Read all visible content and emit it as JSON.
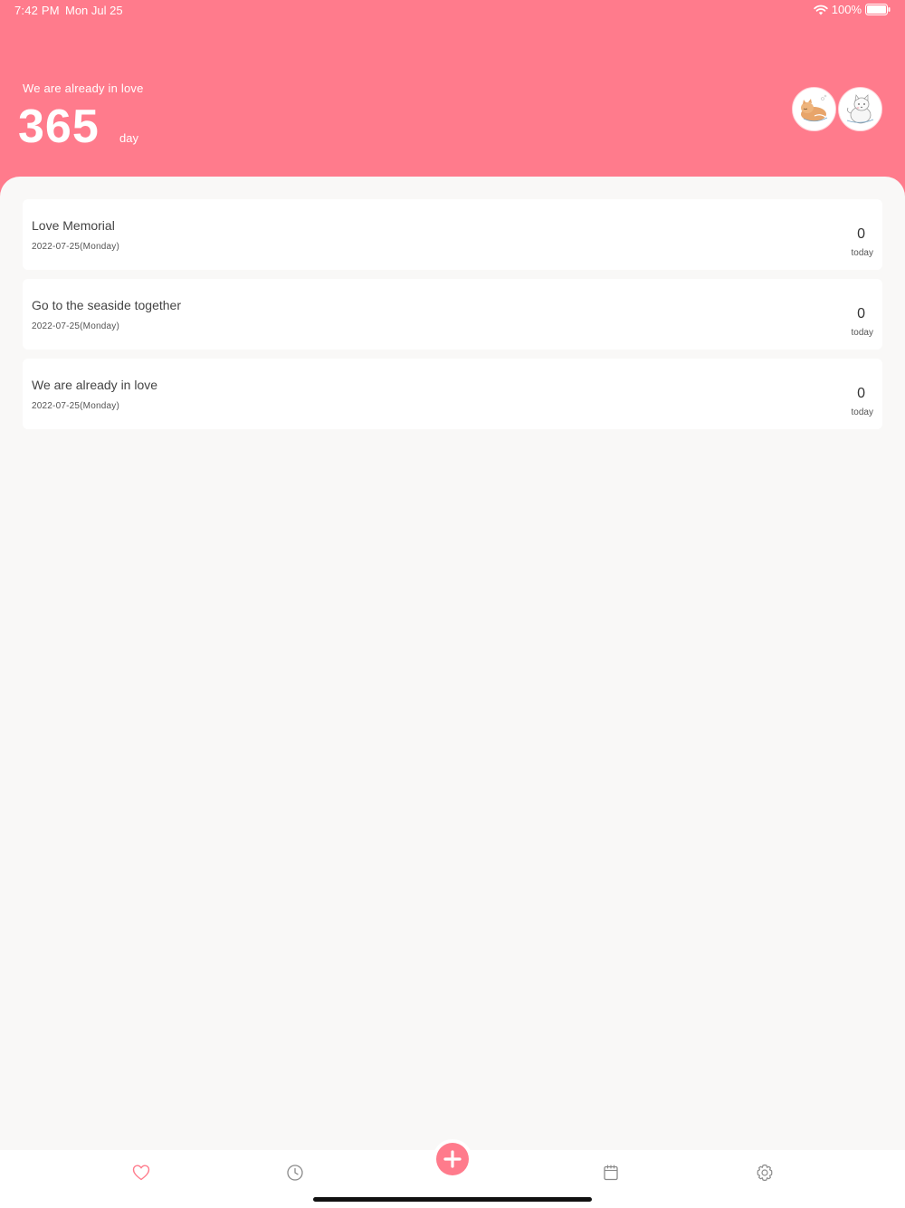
{
  "status_bar": {
    "time": "7:42 PM",
    "date": "Mon Jul 25",
    "battery": "100%"
  },
  "hero": {
    "subtitle": "We are already in love",
    "count": "365",
    "unit": "day"
  },
  "events": [
    {
      "title": "Love Memorial",
      "date": "2022-07-25(Monday)",
      "count": "0",
      "unit": "today"
    },
    {
      "title": "Go to the seaside together",
      "date": "2022-07-25(Monday)",
      "count": "0",
      "unit": "today"
    },
    {
      "title": "We are already in love",
      "date": "2022-07-25(Monday)",
      "count": "0",
      "unit": "today"
    }
  ],
  "tabbar": {
    "icons": [
      "heart-icon",
      "clock-icon",
      "plus-icon",
      "calendar-icon",
      "gear-icon"
    ],
    "active": "heart-icon"
  },
  "colors": {
    "accent": "#ff7b8c",
    "background": "#f9f8f7",
    "card": "#ffffff",
    "inactive_icon": "#8a8a8a"
  }
}
